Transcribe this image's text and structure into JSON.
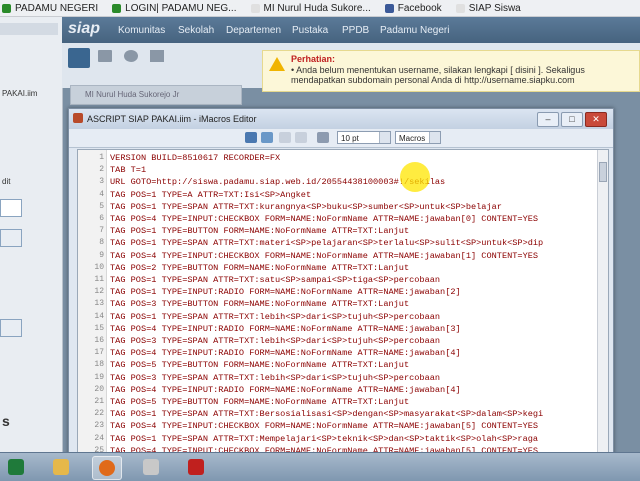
{
  "bookmarks": [
    {
      "label": "PADAMU NEGERI",
      "color": "#2a8a2a"
    },
    {
      "label": "LOGIN| PADAMU NEG...",
      "color": "#2a8a2a"
    },
    {
      "label": "MI Nurul Huda Sukore...",
      "color": "#e0e0e0"
    },
    {
      "label": "Facebook",
      "color": "#3b5998"
    },
    {
      "label": "SIAP Siswa",
      "color": "#e0e0e0"
    }
  ],
  "siap": {
    "logo": "siap",
    "nav": [
      "Komunitas",
      "Sekolah",
      "Departemen",
      "Pustaka",
      "PPDB",
      "Padamu Negeri"
    ],
    "user_name": "MI Nurul Huda Sukorejo Jr"
  },
  "left_pane": {
    "snippet_1": "PAKAI.iim",
    "snippet_2": "dit",
    "snippet_3": "s"
  },
  "warning": {
    "title": "Perhatian:",
    "body": "• Anda belum menentukan username, silakan lengkapi [ disini ]. Sekaligus mendapatkan subdomain personal Anda di http://username.siapku.com"
  },
  "imacros": {
    "title": "ASCRIPT SIAP PAKAI.iim - iMacros Editor",
    "font_size": "10 pt",
    "mode": "Macros",
    "lines": [
      "VERSION BUILD=8510617 RECORDER=FX",
      "TAB T=1",
      "URL GOTO=http://siswa.padamu.siap.web.id/20554438100003#!/sekilas",
      "TAG POS=1 TYPE=A ATTR=TXT:Isi<SP>Angket",
      "TAG POS=1 TYPE=SPAN ATTR=TXT:kurangnya<SP>buku<SP>sumber<SP>untuk<SP>belajar",
      "TAG POS=4 TYPE=INPUT:CHECKBOX FORM=NAME:NoFormName ATTR=NAME:jawaban[0] CONTENT=YES",
      "TAG POS=1 TYPE=BUTTON FORM=NAME:NoFormName ATTR=TXT:Lanjut",
      "TAG POS=1 TYPE=SPAN ATTR=TXT:materi<SP>pelajaran<SP>terlalu<SP>sulit<SP>untuk<SP>dip",
      "TAG POS=4 TYPE=INPUT:CHECKBOX FORM=NAME:NoFormName ATTR=NAME:jawaban[1] CONTENT=YES",
      "TAG POS=2 TYPE=BUTTON FORM=NAME:NoFormName ATTR=TXT:Lanjut",
      "TAG POS=1 TYPE=SPAN ATTR=TXT:satu<SP>sampai<SP>tiga<SP>percobaan",
      "TAG POS=1 TYPE=INPUT:RADIO FORM=NAME:NoFormName ATTR=NAME:jawaban[2]",
      "TAG POS=3 TYPE=BUTTON FORM=NAME:NoFormName ATTR=TXT:Lanjut",
      "TAG POS=1 TYPE=SPAN ATTR=TXT:lebih<SP>dari<SP>tujuh<SP>percobaan",
      "TAG POS=4 TYPE=INPUT:RADIO FORM=NAME:NoFormName ATTR=NAME:jawaban[3]",
      "TAG POS=3 TYPE=SPAN ATTR=TXT:lebih<SP>dari<SP>tujuh<SP>percobaan",
      "TAG POS=4 TYPE=INPUT:RADIO FORM=NAME:NoFormName ATTR=NAME:jawaban[4]",
      "TAG POS=5 TYPE=BUTTON FORM=NAME:NoFormName ATTR=TXT:Lanjut",
      "TAG POS=3 TYPE=SPAN ATTR=TXT:lebih<SP>dari<SP>tujuh<SP>percobaan",
      "TAG POS=4 TYPE=INPUT:RADIO FORM=NAME:NoFormName ATTR=NAME:jawaban[4]",
      "TAG POS=5 TYPE=BUTTON FORM=NAME:NoFormName ATTR=TXT:Lanjut",
      "TAG POS=1 TYPE=SPAN ATTR=TXT:Bersosialisasi<SP>dengan<SP>masyarakat<SP>dalam<SP>kegi",
      "TAG POS=4 TYPE=INPUT:CHECKBOX FORM=NAME:NoFormName ATTR=NAME:jawaban[5] CONTENT=YES",
      "TAG POS=1 TYPE=SPAN ATTR=TXT:Mempelajari<SP>teknik<SP>dan<SP>taktik<SP>olah<SP>raga",
      "TAG POS=4 TYPE=INPUT:CHECKBOX FORM=NAME:NoFormName ATTR=NAME:jawaban[5] CONTENT=YES"
    ]
  },
  "taskbar": [
    {
      "name": "excel",
      "color": "#1f7a3a"
    },
    {
      "name": "explorer",
      "color": "#e6b84a"
    },
    {
      "name": "firefox",
      "color": "#e06a1a"
    },
    {
      "name": "paint",
      "color": "#c8c8c8"
    },
    {
      "name": "acrobat",
      "color": "#c0201e"
    }
  ]
}
